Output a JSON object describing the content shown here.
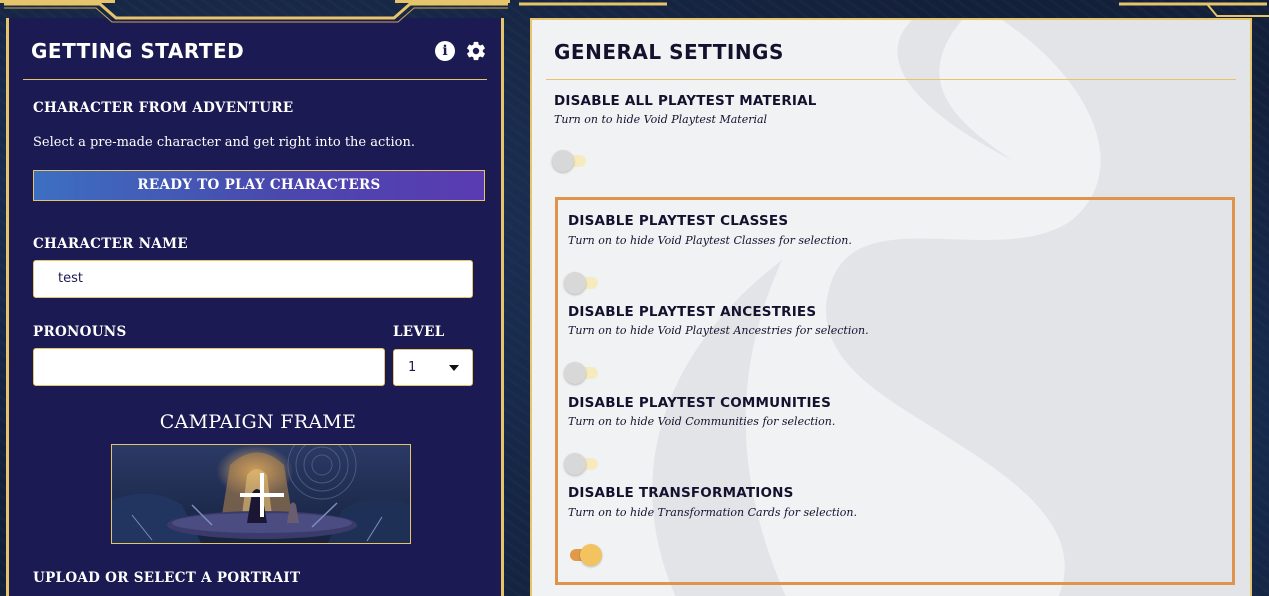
{
  "left_panel": {
    "title": "GETTING STARTED",
    "info_icon": "i",
    "character_from_adventure_label": "CHARACTER FROM ADVENTURE",
    "adventure_description": "Select a pre-made character and get right into the action.",
    "ready_button_label": "READY TO PLAY CHARACTERS",
    "character_name_label": "CHARACTER NAME",
    "character_name_value": "test",
    "pronouns_label": "PRONOUNS",
    "pronouns_value": "",
    "level_label": "LEVEL",
    "level_value": "1",
    "campaign_frame_title": "CAMPAIGN FRAME",
    "portrait_label": "UPLOAD OR SELECT A PORTRAIT"
  },
  "right_panel": {
    "title": "GENERAL SETTINGS",
    "settings": [
      {
        "title": "DISABLE ALL PLAYTEST MATERIAL",
        "subtitle": "Turn on to hide Void Playtest Material",
        "enabled": false
      },
      {
        "title": "DISABLE PLAYTEST CLASSES",
        "subtitle": "Turn on to hide Void Playtest Classes for selection.",
        "enabled": false
      },
      {
        "title": "DISABLE PLAYTEST ANCESTRIES",
        "subtitle": "Turn on to hide Void Playtest Ancestries for selection.",
        "enabled": false
      },
      {
        "title": "DISABLE PLAYTEST COMMUNITIES",
        "subtitle": "Turn on to hide Void Communities for selection.",
        "enabled": false
      },
      {
        "title": "DISABLE TRANSFORMATIONS",
        "subtitle": "Turn on to hide Transformation Cards for selection.",
        "enabled": true
      }
    ]
  },
  "colors": {
    "gold": "#e6c46a",
    "panel_navy": "#1c1a52",
    "settings_bg": "#f1f2f4",
    "highlight_orange": "#e0934a"
  },
  "icons": [
    "info-icon",
    "gear-icon",
    "add-plus-icon",
    "chevron-down-icon"
  ]
}
